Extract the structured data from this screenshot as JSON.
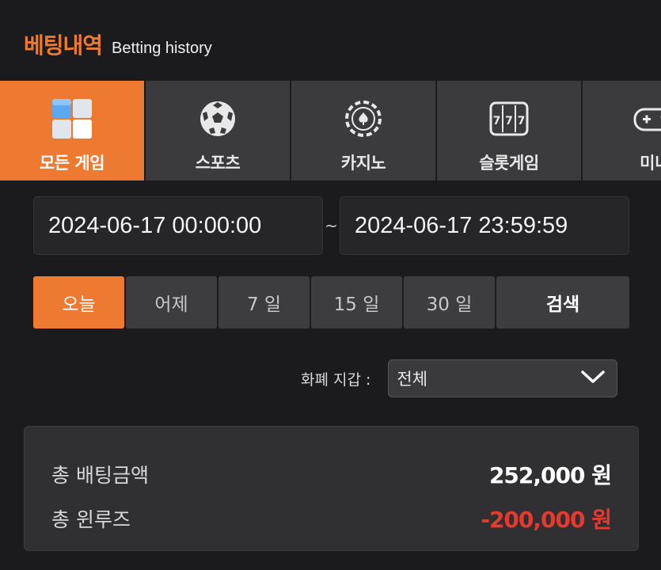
{
  "header": {
    "title_ko": "베팅내역",
    "title_en": "Betting history"
  },
  "tabs": [
    {
      "label": "모든 게임",
      "icon": "all-games-icon",
      "active": true
    },
    {
      "label": "스포츠",
      "icon": "soccer-ball-icon",
      "active": false
    },
    {
      "label": "카지노",
      "icon": "casino-chip-icon",
      "active": false
    },
    {
      "label": "슬롯게임",
      "icon": "slot-machine-icon",
      "active": false
    },
    {
      "label": "미니",
      "icon": "gamepad-icon",
      "active": false
    }
  ],
  "date_range": {
    "start": "2024-06-17 00:00:00",
    "separator": "~",
    "end": "2024-06-17 23:59:59"
  },
  "periods": [
    {
      "label": "오늘",
      "active": true
    },
    {
      "label": "어제",
      "active": false
    },
    {
      "label": "7 일",
      "active": false
    },
    {
      "label": "15 일",
      "active": false
    },
    {
      "label": "30 일",
      "active": false
    }
  ],
  "search_label": "검색",
  "currency_filter": {
    "label": "화폐 지갑 :",
    "value": "전체"
  },
  "summary": {
    "total_bet_label": "총 배팅금액",
    "total_bet_value": "252,000 원",
    "total_winloss_label": "총 윈루즈",
    "total_winloss_value": "-200,000 원"
  },
  "colors": {
    "accent": "#ee7a32",
    "negative": "#e8392f",
    "background": "#1b1b1d"
  }
}
